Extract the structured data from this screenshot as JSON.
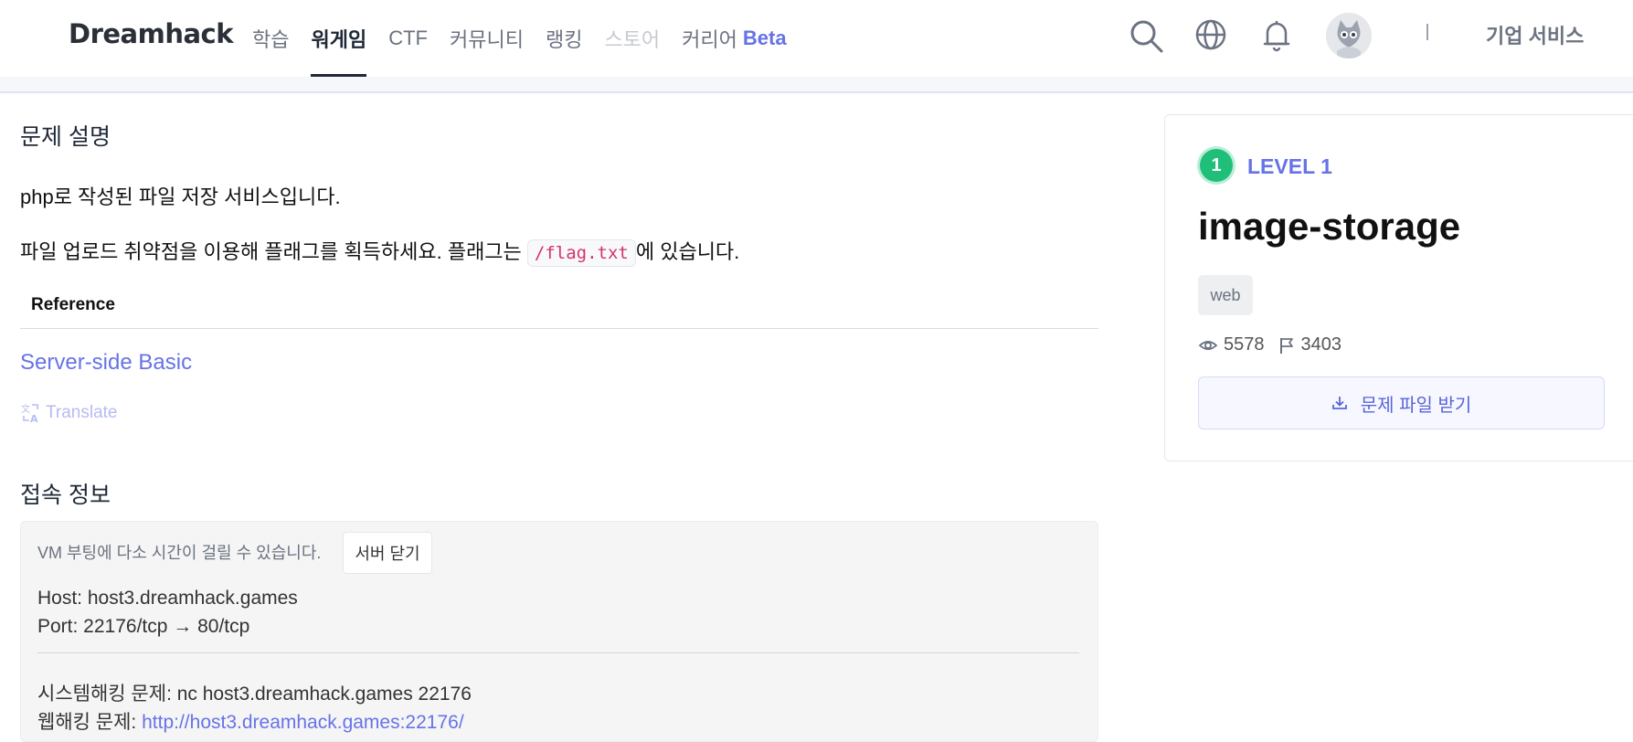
{
  "header": {
    "logo": "Dreamhack",
    "nav": [
      {
        "label": "학습",
        "state": "normal"
      },
      {
        "label": "워게임",
        "state": "active"
      },
      {
        "label": "CTF",
        "state": "normal"
      },
      {
        "label": "커뮤니티",
        "state": "normal"
      },
      {
        "label": "랭킹",
        "state": "normal"
      },
      {
        "label": "스토어",
        "state": "disabled"
      },
      {
        "label": "커리어",
        "state": "normal",
        "badge": "Beta"
      }
    ],
    "icons": [
      "search-icon",
      "globe-icon",
      "bell-icon"
    ],
    "separator": "|",
    "enterprise_label": "기업 서비스"
  },
  "description": {
    "title": "문제 설명",
    "line1": "php로 작성된 파일 저장 서비스입니다.",
    "line2_before": "파일 업로드 취약점을 이용해 플래그를 획득하세요. 플래그는 ",
    "line2_code": "/flag.txt",
    "line2_after": "에 있습니다.",
    "reference_header": "Reference",
    "reference_link": "Server-side Basic",
    "translate_label": "Translate"
  },
  "connection": {
    "title": "접속 정보",
    "vm_note": "VM 부팅에 다소 시간이 걸릴 수 있습니다.",
    "close_button": "서버 닫기",
    "host": "Host: host3.dreamhack.games",
    "port": "Port:  22176/tcp → 80/tcp",
    "system_hacking": "시스템해킹 문제: nc host3.dreamhack.games 22176",
    "web_hacking_label": "웹해킹 문제: ",
    "web_hacking_link": "http://host3.dreamhack.games:22176/"
  },
  "challenge": {
    "level_number": "1",
    "level_label": "LEVEL 1",
    "name": "image-storage",
    "tag": "web",
    "views": "5578",
    "solves": "3403",
    "download_label": "문제 파일 받기"
  },
  "colors": {
    "accent": "#6673e6",
    "level_green": "#1fbf7a",
    "code_text": "#d6336c"
  }
}
